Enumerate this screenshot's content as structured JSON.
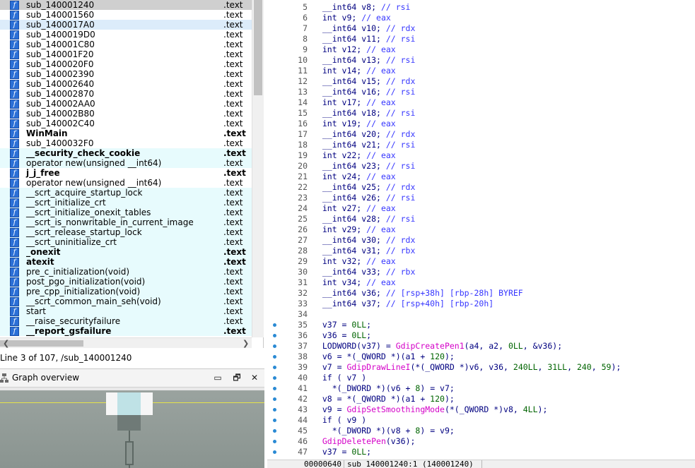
{
  "function_list": {
    "rows": [
      {
        "name": "sub_140001240",
        "segment": ".text",
        "bold": false,
        "state": "sel"
      },
      {
        "name": "sub_140001560",
        "segment": ".text",
        "bold": false,
        "state": ""
      },
      {
        "name": "sub_1400017A0",
        "segment": ".text",
        "bold": false,
        "state": "cur"
      },
      {
        "name": "sub_1400019D0",
        "segment": ".text",
        "bold": false,
        "state": ""
      },
      {
        "name": "sub_140001C80",
        "segment": ".text",
        "bold": false,
        "state": ""
      },
      {
        "name": "sub_140001F20",
        "segment": ".text",
        "bold": false,
        "state": ""
      },
      {
        "name": "sub_1400020F0",
        "segment": ".text",
        "bold": false,
        "state": ""
      },
      {
        "name": "sub_140002390",
        "segment": ".text",
        "bold": false,
        "state": ""
      },
      {
        "name": "sub_140002640",
        "segment": ".text",
        "bold": false,
        "state": ""
      },
      {
        "name": "sub_140002870",
        "segment": ".text",
        "bold": false,
        "state": ""
      },
      {
        "name": "sub_140002AA0",
        "segment": ".text",
        "bold": false,
        "state": ""
      },
      {
        "name": "sub_140002B80",
        "segment": ".text",
        "bold": false,
        "state": ""
      },
      {
        "name": "sub_140002C40",
        "segment": ".text",
        "bold": false,
        "state": ""
      },
      {
        "name": "WinMain",
        "segment": ".text",
        "bold": true,
        "state": ""
      },
      {
        "name": "sub_1400032F0",
        "segment": ".text",
        "bold": false,
        "state": ""
      },
      {
        "name": "__security_check_cookie",
        "segment": ".text",
        "bold": true,
        "state": "alt"
      },
      {
        "name": "operator new(unsigned __int64)",
        "segment": ".text",
        "bold": false,
        "state": "alt"
      },
      {
        "name": "j_j_free",
        "segment": ".text",
        "bold": true,
        "state": ""
      },
      {
        "name": "operator new(unsigned __int64)",
        "segment": ".text",
        "bold": false,
        "state": ""
      },
      {
        "name": "__scrt_acquire_startup_lock",
        "segment": ".text",
        "bold": false,
        "state": "alt"
      },
      {
        "name": "__scrt_initialize_crt",
        "segment": ".text",
        "bold": false,
        "state": "alt"
      },
      {
        "name": "__scrt_initialize_onexit_tables",
        "segment": ".text",
        "bold": false,
        "state": "alt"
      },
      {
        "name": "__scrt_is_nonwritable_in_current_image",
        "segment": ".text",
        "bold": false,
        "state": "alt"
      },
      {
        "name": "__scrt_release_startup_lock",
        "segment": ".text",
        "bold": false,
        "state": "alt"
      },
      {
        "name": "__scrt_uninitialize_crt",
        "segment": ".text",
        "bold": false,
        "state": "alt"
      },
      {
        "name": "_onexit",
        "segment": ".text",
        "bold": true,
        "state": "alt"
      },
      {
        "name": "atexit",
        "segment": ".text",
        "bold": true,
        "state": "alt"
      },
      {
        "name": "pre_c_initialization(void)",
        "segment": ".text",
        "bold": false,
        "state": "alt"
      },
      {
        "name": "post_pgo_initialization(void)",
        "segment": ".text",
        "bold": false,
        "state": "alt"
      },
      {
        "name": "pre_cpp_initialization(void)",
        "segment": ".text",
        "bold": false,
        "state": "alt"
      },
      {
        "name": "__scrt_common_main_seh(void)",
        "segment": ".text",
        "bold": false,
        "state": "alt"
      },
      {
        "name": "start",
        "segment": ".text",
        "bold": false,
        "state": "alt"
      },
      {
        "name": "__raise_securityfailure",
        "segment": ".text",
        "bold": false,
        "state": "alt"
      },
      {
        "name": "__report_gsfailure",
        "segment": ".text",
        "bold": true,
        "state": "alt"
      }
    ],
    "icon_glyph": "f",
    "icon_name": "function-icon",
    "scroll_left_glyph": "❮",
    "scroll_right_glyph": "❯"
  },
  "status": {
    "line_text": "Line 3 of 107, /sub_140001240"
  },
  "graph_overview": {
    "title": "Graph overview",
    "restore_glyph": "🗗",
    "close_glyph": "✕",
    "pin_glyph": "▭"
  },
  "pseudocode": {
    "lines": [
      {
        "n": "5",
        "bp": false,
        "tokens": [
          [
            "kw",
            "  __int64 v8; "
          ],
          [
            "cmt",
            "// rsi"
          ]
        ]
      },
      {
        "n": "6",
        "bp": false,
        "tokens": [
          [
            "kw",
            "  int v9; "
          ],
          [
            "cmt",
            "// eax"
          ]
        ]
      },
      {
        "n": "7",
        "bp": false,
        "tokens": [
          [
            "kw",
            "  __int64 v10; "
          ],
          [
            "cmt",
            "// rdx"
          ]
        ]
      },
      {
        "n": "8",
        "bp": false,
        "tokens": [
          [
            "kw",
            "  __int64 v11; "
          ],
          [
            "cmt",
            "// rsi"
          ]
        ]
      },
      {
        "n": "9",
        "bp": false,
        "tokens": [
          [
            "kw",
            "  int v12; "
          ],
          [
            "cmt",
            "// eax"
          ]
        ]
      },
      {
        "n": "10",
        "bp": false,
        "tokens": [
          [
            "kw",
            "  __int64 v13; "
          ],
          [
            "cmt",
            "// rsi"
          ]
        ]
      },
      {
        "n": "11",
        "bp": false,
        "tokens": [
          [
            "kw",
            "  int v14; "
          ],
          [
            "cmt",
            "// eax"
          ]
        ]
      },
      {
        "n": "12",
        "bp": false,
        "tokens": [
          [
            "kw",
            "  __int64 v15; "
          ],
          [
            "cmt",
            "// rdx"
          ]
        ]
      },
      {
        "n": "13",
        "bp": false,
        "tokens": [
          [
            "kw",
            "  __int64 v16; "
          ],
          [
            "cmt",
            "// rsi"
          ]
        ]
      },
      {
        "n": "14",
        "bp": false,
        "tokens": [
          [
            "kw",
            "  int v17; "
          ],
          [
            "cmt",
            "// eax"
          ]
        ]
      },
      {
        "n": "15",
        "bp": false,
        "tokens": [
          [
            "kw",
            "  __int64 v18; "
          ],
          [
            "cmt",
            "// rsi"
          ]
        ]
      },
      {
        "n": "16",
        "bp": false,
        "tokens": [
          [
            "kw",
            "  int v19; "
          ],
          [
            "cmt",
            "// eax"
          ]
        ]
      },
      {
        "n": "17",
        "bp": false,
        "tokens": [
          [
            "kw",
            "  __int64 v20; "
          ],
          [
            "cmt",
            "// rdx"
          ]
        ]
      },
      {
        "n": "18",
        "bp": false,
        "tokens": [
          [
            "kw",
            "  __int64 v21; "
          ],
          [
            "cmt",
            "// rsi"
          ]
        ]
      },
      {
        "n": "19",
        "bp": false,
        "tokens": [
          [
            "kw",
            "  int v22; "
          ],
          [
            "cmt",
            "// eax"
          ]
        ]
      },
      {
        "n": "20",
        "bp": false,
        "tokens": [
          [
            "kw",
            "  __int64 v23; "
          ],
          [
            "cmt",
            "// rsi"
          ]
        ]
      },
      {
        "n": "21",
        "bp": false,
        "tokens": [
          [
            "kw",
            "  int v24; "
          ],
          [
            "cmt",
            "// eax"
          ]
        ]
      },
      {
        "n": "22",
        "bp": false,
        "tokens": [
          [
            "kw",
            "  __int64 v25; "
          ],
          [
            "cmt",
            "// rdx"
          ]
        ]
      },
      {
        "n": "23",
        "bp": false,
        "tokens": [
          [
            "kw",
            "  __int64 v26; "
          ],
          [
            "cmt",
            "// rsi"
          ]
        ]
      },
      {
        "n": "24",
        "bp": false,
        "tokens": [
          [
            "kw",
            "  int v27; "
          ],
          [
            "cmt",
            "// eax"
          ]
        ]
      },
      {
        "n": "25",
        "bp": false,
        "tokens": [
          [
            "kw",
            "  __int64 v28; "
          ],
          [
            "cmt",
            "// rsi"
          ]
        ]
      },
      {
        "n": "26",
        "bp": false,
        "tokens": [
          [
            "kw",
            "  int v29; "
          ],
          [
            "cmt",
            "// eax"
          ]
        ]
      },
      {
        "n": "27",
        "bp": false,
        "tokens": [
          [
            "kw",
            "  __int64 v30; "
          ],
          [
            "cmt",
            "// rdx"
          ]
        ]
      },
      {
        "n": "28",
        "bp": false,
        "tokens": [
          [
            "kw",
            "  __int64 v31; "
          ],
          [
            "cmt",
            "// rbx"
          ]
        ]
      },
      {
        "n": "29",
        "bp": false,
        "tokens": [
          [
            "kw",
            "  int v32; "
          ],
          [
            "cmt",
            "// eax"
          ]
        ]
      },
      {
        "n": "30",
        "bp": false,
        "tokens": [
          [
            "kw",
            "  __int64 v33; "
          ],
          [
            "cmt",
            "// rbx"
          ]
        ]
      },
      {
        "n": "31",
        "bp": false,
        "tokens": [
          [
            "kw",
            "  int v34; "
          ],
          [
            "cmt",
            "// eax"
          ]
        ]
      },
      {
        "n": "32",
        "bp": false,
        "tokens": [
          [
            "kw",
            "  __int64 v36; "
          ],
          [
            "cmt",
            "// [rsp+38h] [rbp-28h] BYREF"
          ]
        ]
      },
      {
        "n": "33",
        "bp": false,
        "tokens": [
          [
            "kw",
            "  __int64 v37; "
          ],
          [
            "cmt",
            "// [rsp+40h] [rbp-20h]"
          ]
        ]
      },
      {
        "n": "34",
        "bp": false,
        "tokens": [
          [
            "kw",
            ""
          ]
        ]
      },
      {
        "n": "35",
        "bp": true,
        "tokens": [
          [
            "kw",
            "  v37 = "
          ],
          [
            "num",
            "0LL"
          ],
          [
            "kw",
            ";"
          ]
        ]
      },
      {
        "n": "36",
        "bp": true,
        "tokens": [
          [
            "kw",
            "  v36 = "
          ],
          [
            "num",
            "0LL"
          ],
          [
            "kw",
            ";"
          ]
        ]
      },
      {
        "n": "37",
        "bp": true,
        "tokens": [
          [
            "kw",
            "  LODWORD(v37) = "
          ],
          [
            "fn",
            "GdipCreatePen1"
          ],
          [
            "kw",
            "(a4, a2, "
          ],
          [
            "num",
            "0LL"
          ],
          [
            "kw",
            ", &v36);"
          ]
        ]
      },
      {
        "n": "38",
        "bp": true,
        "tokens": [
          [
            "kw",
            "  v6 = *(_QWORD *)(a1 + "
          ],
          [
            "num",
            "120"
          ],
          [
            "kw",
            ");"
          ]
        ]
      },
      {
        "n": "39",
        "bp": true,
        "tokens": [
          [
            "kw",
            "  v7 = "
          ],
          [
            "fn",
            "GdipDrawLineI"
          ],
          [
            "kw",
            "(*(_QWORD *)v6, v36, "
          ],
          [
            "num",
            "240LL"
          ],
          [
            "kw",
            ", "
          ],
          [
            "num",
            "31LL"
          ],
          [
            "kw",
            ", "
          ],
          [
            "num",
            "240"
          ],
          [
            "kw",
            ", "
          ],
          [
            "num",
            "59"
          ],
          [
            "kw",
            ");"
          ]
        ]
      },
      {
        "n": "40",
        "bp": true,
        "tokens": [
          [
            "kw",
            "  if ( v7 )"
          ]
        ]
      },
      {
        "n": "41",
        "bp": true,
        "tokens": [
          [
            "kw",
            "    *(_DWORD *)(v6 + "
          ],
          [
            "num",
            "8"
          ],
          [
            "kw",
            ") = v7;"
          ]
        ]
      },
      {
        "n": "42",
        "bp": true,
        "tokens": [
          [
            "kw",
            "  v8 = *(_QWORD *)(a1 + "
          ],
          [
            "num",
            "120"
          ],
          [
            "kw",
            ");"
          ]
        ]
      },
      {
        "n": "43",
        "bp": true,
        "tokens": [
          [
            "kw",
            "  v9 = "
          ],
          [
            "fn",
            "GdipSetSmoothingMode"
          ],
          [
            "kw",
            "(*(_QWORD *)v8, "
          ],
          [
            "num",
            "4LL"
          ],
          [
            "kw",
            ");"
          ]
        ]
      },
      {
        "n": "44",
        "bp": true,
        "tokens": [
          [
            "kw",
            "  if ( v9 )"
          ]
        ]
      },
      {
        "n": "45",
        "bp": true,
        "tokens": [
          [
            "kw",
            "    *(_DWORD *)(v8 + "
          ],
          [
            "num",
            "8"
          ],
          [
            "kw",
            ") = v9;"
          ]
        ]
      },
      {
        "n": "46",
        "bp": true,
        "tokens": [
          [
            "kw",
            "  "
          ],
          [
            "fn",
            "GdipDeletePen"
          ],
          [
            "kw",
            "(v36);"
          ]
        ]
      },
      {
        "n": "47",
        "bp": true,
        "tokens": [
          [
            "kw",
            "  v37 = "
          ],
          [
            "num",
            "0LL"
          ],
          [
            "kw",
            ";"
          ]
        ]
      }
    ],
    "status_offset": "00000640",
    "status_location": "sub_140001240:1 (140001240)"
  },
  "colors": {
    "function_icon": "#2b6fd6",
    "alt_row": "#e7fbfd",
    "selected_row": "#cfcfcf",
    "comment": "#3636ff",
    "function_call": "#d400c8",
    "number": "#006400",
    "code": "#000080",
    "breakpoint_dot": "#2a8ad4"
  }
}
